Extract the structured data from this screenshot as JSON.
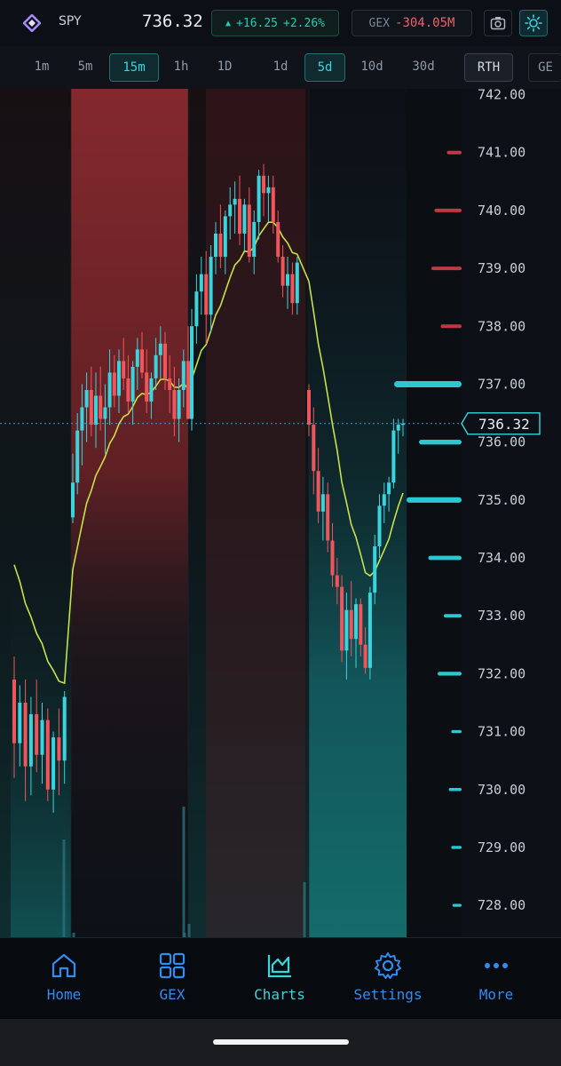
{
  "header": {
    "symbol": "SPY",
    "price": "736.32",
    "change_arrow": "▲",
    "change_abs": "+16.25",
    "change_pct": "+2.26%",
    "gex_label": "GEX",
    "gex_value": "-304.05M",
    "icons": [
      "logo-diamond-icon",
      "camera-icon",
      "sun-icon"
    ]
  },
  "timeframes": [
    {
      "label": "1m",
      "active": false
    },
    {
      "label": "5m",
      "active": false
    },
    {
      "label": "15m",
      "active": true
    },
    {
      "label": "1h",
      "active": false
    },
    {
      "label": "1D",
      "active": false
    }
  ],
  "ranges": [
    {
      "label": "1d",
      "active": false
    },
    {
      "label": "5d",
      "active": true
    },
    {
      "label": "10d",
      "active": false
    },
    {
      "label": "30d",
      "active": false
    }
  ],
  "session_button": "RTH",
  "overflow_button": "GE",
  "chart_data": {
    "type": "candlestick",
    "y_axis_labels": [
      "742.00",
      "741.00",
      "740.00",
      "739.00",
      "738.00",
      "737.00",
      "736.00",
      "735.00",
      "734.00",
      "733.00",
      "732.00",
      "731.00",
      "730.00",
      "729.00",
      "728.00"
    ],
    "ylim": [
      727.45,
      742.1
    ],
    "current_price_label": "736.32",
    "current_price": 736.32,
    "colors": {
      "up": "#3ad4dc",
      "down": "#f0555c",
      "ma": "#c8e04a",
      "price_line": "#3a9bdc"
    },
    "candles": [
      [
        731.9,
        732.3,
        730.2,
        730.8
      ],
      [
        730.8,
        731.8,
        730.4,
        731.5
      ],
      [
        731.5,
        731.9,
        729.8,
        730.4
      ],
      [
        730.4,
        731.6,
        729.9,
        731.3
      ],
      [
        731.3,
        731.9,
        730.3,
        730.6
      ],
      [
        730.6,
        731.5,
        730.1,
        731.2
      ],
      [
        731.2,
        731.4,
        729.8,
        730.0
      ],
      [
        730.0,
        731.0,
        729.6,
        730.9
      ],
      [
        730.9,
        731.4,
        729.9,
        730.5
      ],
      [
        730.5,
        731.7,
        730.1,
        731.6
      ],
      [
        734.7,
        735.8,
        734.6,
        735.3
      ],
      [
        735.3,
        736.5,
        735.1,
        736.2
      ],
      [
        736.2,
        737.0,
        735.6,
        736.6
      ],
      [
        736.6,
        737.2,
        736.0,
        736.9
      ],
      [
        736.9,
        737.3,
        736.1,
        736.3
      ],
      [
        736.3,
        737.2,
        735.9,
        736.8
      ],
      [
        736.8,
        737.3,
        736.2,
        736.4
      ],
      [
        736.4,
        737.0,
        735.8,
        736.6
      ],
      [
        736.6,
        737.6,
        736.3,
        737.2
      ],
      [
        737.2,
        737.5,
        736.6,
        736.8
      ],
      [
        736.8,
        737.6,
        736.5,
        737.4
      ],
      [
        737.4,
        737.8,
        736.9,
        737.1
      ],
      [
        737.1,
        737.5,
        736.5,
        736.7
      ],
      [
        736.7,
        737.4,
        736.3,
        737.3
      ],
      [
        737.3,
        737.8,
        736.9,
        737.6
      ],
      [
        737.6,
        737.9,
        737.1,
        737.2
      ],
      [
        737.2,
        737.6,
        736.5,
        736.7
      ],
      [
        736.7,
        737.2,
        736.4,
        737.1
      ],
      [
        737.1,
        737.8,
        736.9,
        737.5
      ],
      [
        737.5,
        738.0,
        737.1,
        737.7
      ],
      [
        737.7,
        737.9,
        736.9,
        737.1
      ],
      [
        737.1,
        737.5,
        736.5,
        736.9
      ],
      [
        736.9,
        737.3,
        736.1,
        736.4
      ],
      [
        736.4,
        737.1,
        736.0,
        736.9
      ],
      [
        736.9,
        737.6,
        736.6,
        737.4
      ],
      [
        737.4,
        738.0,
        736.4,
        736.4
      ],
      [
        736.4,
        738.3,
        736.2,
        738.0
      ],
      [
        738.0,
        738.9,
        737.7,
        738.6
      ],
      [
        738.6,
        739.2,
        738.2,
        738.9
      ],
      [
        738.9,
        739.3,
        737.7,
        738.2
      ],
      [
        738.2,
        739.4,
        737.9,
        739.2
      ],
      [
        739.2,
        739.8,
        738.9,
        739.6
      ],
      [
        739.6,
        740.1,
        739.0,
        739.2
      ],
      [
        739.2,
        740.0,
        738.9,
        739.9
      ],
      [
        739.9,
        740.4,
        739.5,
        740.1
      ],
      [
        740.1,
        740.5,
        739.6,
        740.2
      ],
      [
        740.2,
        740.6,
        739.4,
        739.6
      ],
      [
        739.6,
        740.2,
        739.3,
        740.1
      ],
      [
        740.1,
        740.4,
        739.1,
        739.2
      ],
      [
        739.2,
        740.0,
        738.9,
        739.8
      ],
      [
        739.8,
        740.7,
        739.5,
        740.6
      ],
      [
        740.6,
        740.8,
        739.9,
        740.3
      ],
      [
        740.3,
        740.6,
        739.8,
        740.4
      ],
      [
        740.4,
        740.6,
        739.6,
        739.8
      ],
      [
        739.8,
        740.0,
        739.1,
        739.2
      ],
      [
        739.2,
        739.4,
        738.5,
        738.7
      ],
      [
        738.7,
        739.2,
        738.3,
        738.9
      ],
      [
        738.9,
        739.1,
        738.2,
        738.4
      ],
      [
        738.4,
        739.2,
        738.2,
        739.1
      ],
      [
        736.9,
        737.0,
        736.1,
        736.3
      ],
      [
        736.3,
        736.6,
        735.1,
        735.5
      ],
      [
        735.5,
        735.9,
        734.6,
        734.8
      ],
      [
        734.8,
        735.4,
        734.3,
        735.1
      ],
      [
        735.1,
        735.3,
        734.1,
        734.3
      ],
      [
        734.3,
        734.6,
        733.5,
        733.7
      ],
      [
        733.7,
        734.0,
        733.2,
        733.5
      ],
      [
        733.5,
        733.7,
        732.2,
        732.4
      ],
      [
        732.4,
        733.4,
        731.9,
        733.1
      ],
      [
        733.1,
        733.6,
        732.3,
        732.6
      ],
      [
        732.6,
        733.3,
        732.1,
        733.2
      ],
      [
        733.2,
        733.3,
        732.3,
        732.5
      ],
      [
        732.5,
        732.8,
        732.0,
        732.1
      ],
      [
        732.1,
        733.5,
        731.9,
        733.4
      ],
      [
        733.4,
        734.4,
        733.2,
        734.2
      ],
      [
        734.2,
        735.1,
        734.0,
        734.9
      ],
      [
        734.9,
        735.3,
        734.6,
        735.1
      ],
      [
        735.1,
        735.4,
        734.8,
        735.3
      ],
      [
        735.3,
        736.4,
        735.2,
        736.2
      ],
      [
        736.2,
        736.4,
        735.8,
        736.3
      ],
      [
        736.3,
        736.4,
        736.1,
        736.32
      ]
    ],
    "gex_levels": [
      {
        "price": 741.0,
        "sign": "negative",
        "magnitude": 0.15
      },
      {
        "price": 740.0,
        "sign": "negative",
        "magnitude": 0.35
      },
      {
        "price": 739.0,
        "sign": "negative",
        "magnitude": 0.4
      },
      {
        "price": 738.0,
        "sign": "negative",
        "magnitude": 0.25
      },
      {
        "price": 737.0,
        "sign": "positive",
        "magnitude": 1.0
      },
      {
        "price": 736.0,
        "sign": "positive",
        "magnitude": 0.6
      },
      {
        "price": 735.0,
        "sign": "positive",
        "magnitude": 0.8
      },
      {
        "price": 734.0,
        "sign": "positive",
        "magnitude": 0.45
      },
      {
        "price": 733.0,
        "sign": "positive",
        "magnitude": 0.2
      },
      {
        "price": 732.0,
        "sign": "positive",
        "magnitude": 0.3
      },
      {
        "price": 731.0,
        "sign": "positive",
        "magnitude": 0.08
      },
      {
        "price": 730.0,
        "sign": "positive",
        "magnitude": 0.12
      },
      {
        "price": 729.0,
        "sign": "positive",
        "magnitude": 0.08
      },
      {
        "price": 728.0,
        "sign": "positive",
        "magnitude": 0.06
      }
    ]
  },
  "nav": {
    "items": [
      {
        "label": "Home",
        "icon": "home-icon"
      },
      {
        "label": "GEX",
        "icon": "grid-icon"
      },
      {
        "label": "Charts",
        "icon": "chart-icon",
        "active": true
      },
      {
        "label": "Settings",
        "icon": "gear-icon"
      },
      {
        "label": "More",
        "icon": "more-dots-icon"
      }
    ]
  }
}
